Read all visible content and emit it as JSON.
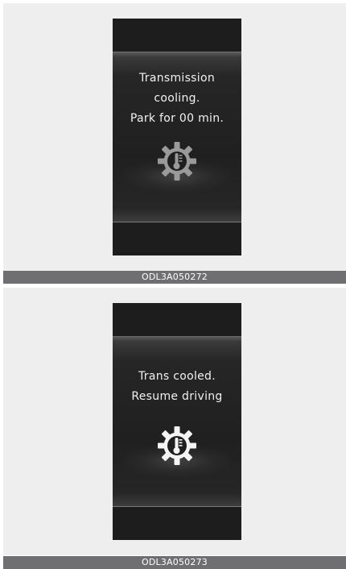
{
  "figures": [
    {
      "message_lines": [
        "Transmission",
        "cooling.",
        "Park for 00 min."
      ],
      "icon": "transmission-temperature-gear-icon",
      "caption": "ODL3A050272",
      "icon_color": "#aaaaaa"
    },
    {
      "message_lines": [
        "Trans cooled.",
        "Resume driving"
      ],
      "icon": "transmission-temperature-gear-icon",
      "caption": "ODL3A050273",
      "icon_color": "#ffffff"
    }
  ],
  "colors": {
    "page_background": "#ffffff",
    "panel_background": "#eeeeee",
    "caption_bar": "#6f6f71",
    "screen_background": "#1d1d1d"
  }
}
